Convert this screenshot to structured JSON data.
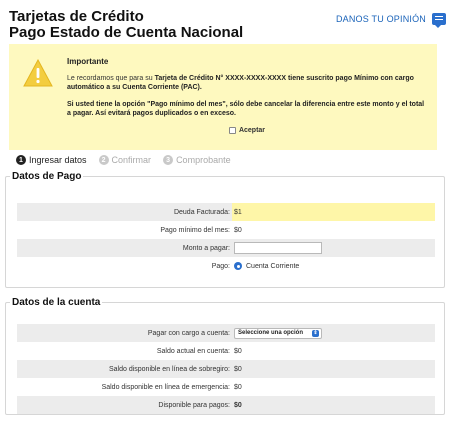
{
  "header": {
    "title_line1": "Tarjetas de Crédito",
    "title_line2": "Pago Estado de Cuenta Nacional",
    "feedback_label": "DANOS TU OPINIÓN"
  },
  "notice": {
    "title": "Importante",
    "p1_prefix": "Le recordamos que para su ",
    "p1_bold": "Tarjeta de Crédito N° XXXX-XXXX-XXXX",
    "p1_suffix": " tiene suscrito pago Mínimo con cargo automático a su Cuenta Corriente (PAC).",
    "p2": "Si usted tiene la opción \"Pago mínimo del mes\", sólo debe cancelar la diferencia entre este monto y el total a pagar. Así evitará pagos duplicados o en exceso.",
    "accept_label": "Aceptar"
  },
  "steps": [
    {
      "num": "1",
      "label": "Ingresar datos"
    },
    {
      "num": "2",
      "label": "Confirmar"
    },
    {
      "num": "3",
      "label": "Comprobante"
    }
  ],
  "pago": {
    "legend": "Datos de Pago",
    "deuda_label": "Deuda Facturada:",
    "deuda_value": "$1",
    "minimo_label": "Pago mínimo del mes:",
    "minimo_value": "$0",
    "monto_label": "Monto a pagar:",
    "monto_value": "",
    "pago_label": "Pago:",
    "pago_option": "Cuenta Corriente"
  },
  "cuenta": {
    "legend": "Datos de la cuenta",
    "cargo_label": "Pagar con cargo a cuenta:",
    "cargo_select": "Seleccione una opción",
    "saldo_actual_label": "Saldo actual en cuenta:",
    "saldo_actual_value": "$0",
    "sobregiro_label": "Saldo disponible en línea de sobregiro:",
    "sobregiro_value": "$0",
    "emergencia_label": "Saldo disponible en línea de emergencia:",
    "emergencia_value": "$0",
    "disponible_label": "Disponible para pagos:",
    "disponible_value": "$0"
  },
  "colors": {
    "accent": "#2a6fcd",
    "notice_bg": "#fef9bf",
    "highlight": "#fef6a8"
  }
}
